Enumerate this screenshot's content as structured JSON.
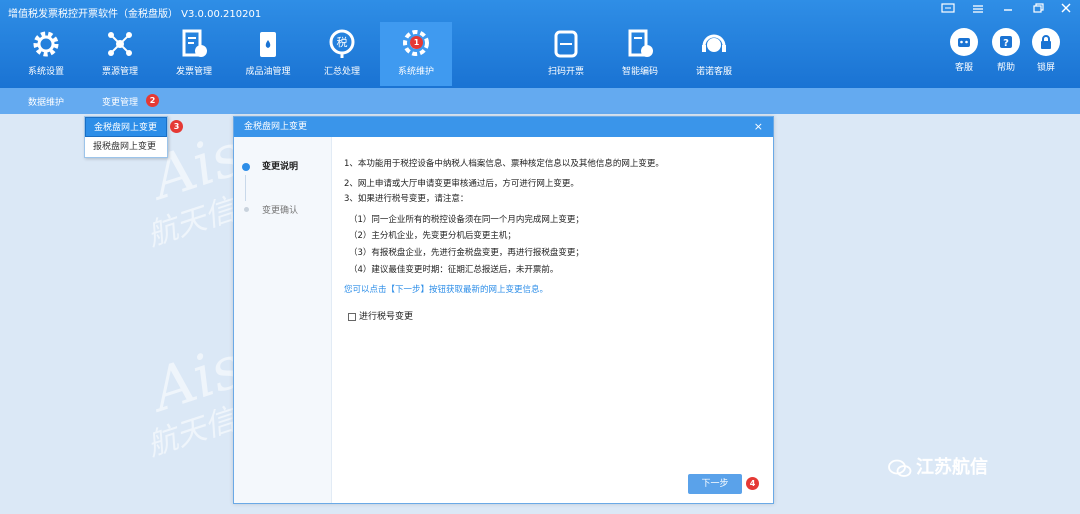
{
  "window": {
    "title": "增值税发票税控开票软件（金税盘版） V3.0.00.210201"
  },
  "nav": {
    "items": [
      {
        "label": "系统设置",
        "icon": "gear-icon"
      },
      {
        "label": "票源管理",
        "icon": "network-icon"
      },
      {
        "label": "发票管理",
        "icon": "invoice-icon"
      },
      {
        "label": "成品油管理",
        "icon": "oil-icon"
      },
      {
        "label": "汇总处理",
        "icon": "tax-icon"
      },
      {
        "label": "系统维护",
        "icon": "maintenance-icon",
        "badge": "1"
      },
      {
        "label": "扫码开票",
        "icon": "scan-icon"
      },
      {
        "label": "智能编码",
        "icon": "code-icon"
      },
      {
        "label": "诺诺客服",
        "icon": "headset-icon"
      }
    ],
    "right": [
      {
        "label": "客服",
        "icon": "robot-icon"
      },
      {
        "label": "帮助",
        "icon": "help-icon"
      },
      {
        "label": "锁屏",
        "icon": "lock-icon"
      }
    ]
  },
  "subnav": {
    "items": [
      "数据维护",
      "变更管理"
    ],
    "badge": "2"
  },
  "dropdown": {
    "items": [
      "金税盘网上变更",
      "报税盘网上变更"
    ],
    "badge": "3"
  },
  "dialog": {
    "title": "金税盘网上变更",
    "close": "×",
    "steps": [
      "变更说明",
      "变更确认"
    ],
    "lines": [
      "1、本功能用于税控设备中纳税人档案信息、票种核定信息以及其他信息的网上变更。",
      "2、网上申请或大厅申请变更审核通过后，方可进行网上变更。",
      "3、如果进行税号变更，请注意：",
      "（1）同一企业所有的税控设备须在同一个月内完成网上变更；",
      "（2）主分机企业，先变更分机后变更主机；",
      "（3）有报税盘企业，先进行金税盘变更，再进行报税盘变更；",
      "（4）建议最佳变更时期：征期汇总报送后，未开票前。"
    ],
    "hint": "您可以点击【下一步】按钮获取最新的网上变更信息。",
    "checkbox_label": "进行税号变更",
    "next_button": "下一步",
    "next_badge": "4"
  },
  "watermark": {
    "text_en": "Aisino",
    "text_cn": "航天信息江苏有限公司"
  },
  "brand": "江苏航信",
  "colors": {
    "header": "#1a73d3",
    "subnav": "#64aaf0",
    "accent": "#2d8ee8",
    "badge": "#e53935"
  }
}
